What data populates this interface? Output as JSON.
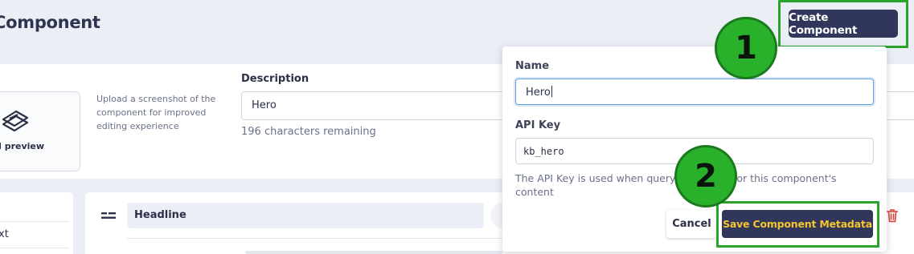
{
  "header": {
    "title": "Component",
    "create_button": "Create Component"
  },
  "upload": {
    "label": "d preview",
    "help": "Upload a screenshot of the component for improved editing experience",
    "icon": "upload-stack-icon"
  },
  "description": {
    "label": "Description",
    "value": "Hero",
    "remaining": "196 characters remaining"
  },
  "left_panel": {
    "item_text": "xt"
  },
  "editor": {
    "field_value": "Headline",
    "drag_icon": "drag-handle-icon",
    "delete_icon": "trash-icon"
  },
  "popover": {
    "name_label": "Name",
    "name_value": "Hero",
    "apikey_label": "API Key",
    "apikey_value": "kb_hero",
    "apikey_help": "The API Key is used when querying the API for this component's content",
    "cancel_button": "Cancel",
    "save_button": "Save Component Metadata"
  },
  "steps": {
    "one": "1",
    "two": "2"
  },
  "colors": {
    "primary_button": "#30375a",
    "save_text": "#f5c530",
    "highlight": "#29a32b",
    "focus_border": "#6a9fe0",
    "danger": "#d9453f"
  }
}
